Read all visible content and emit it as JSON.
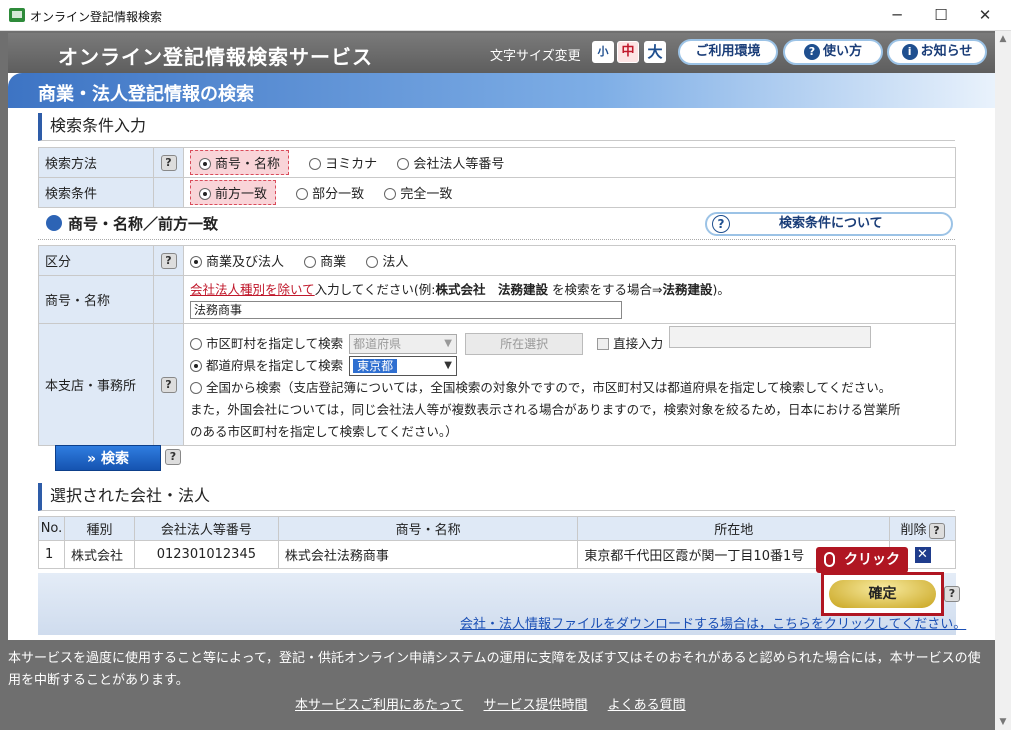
{
  "window": {
    "title": "オンライン登記情報検索"
  },
  "header": {
    "app_title": "オンライン登記情報検索サービス",
    "font_size_label": "文字サイズ変更",
    "font_sizes": [
      "小",
      "中",
      "大"
    ],
    "env_label": "ご利用環境",
    "howto_label": "使い方",
    "notice_label": "お知らせ"
  },
  "banner": {
    "title": "商業・法人登記情報の検索"
  },
  "search_section": {
    "title": "検索条件入力",
    "method_label": "検索方法",
    "method_options": [
      "商号・名称",
      "ヨミカナ",
      "会社法人等番号"
    ],
    "condition_label": "検索条件",
    "condition_options": [
      "前方一致",
      "部分一致",
      "完全一致"
    ]
  },
  "sub": {
    "title": "商号・名称／前方一致",
    "about_label": "検索条件について"
  },
  "form": {
    "kubun_label": "区分",
    "kubun_options": [
      "商業及び法人",
      "商業",
      "法人"
    ],
    "name_label": "商号・名称",
    "name_hint_link": "会社法人種別を除いて",
    "name_hint_rest": "入力してください(例:",
    "name_hint_bold1": "株式会社　法務建設",
    "name_hint_mid": " を検索をする場合⇒",
    "name_hint_bold2": "法務建設",
    "name_hint_end": ")。",
    "name_value": "法務商事",
    "office_label": "本支店・事務所",
    "opt_city": "市区町村を指定して検索",
    "pref_placeholder": "都道府県",
    "locate_btn": "所在選択",
    "direct_label": "直接入力",
    "opt_pref": "都道府県を指定して検索",
    "pref_value": "東京都",
    "opt_all": "全国から検索（支店登記簿については，全国検索の対象外ですので，市区町村又は都道府県を指定して検索してください。",
    "note1": "また，外国会社については，同じ会社法人等が複数表示される場合がありますので，検索対象を絞るため，日本における営業所",
    "note2": "のある市区町村を指定して検索してください。）"
  },
  "search_btn": "検索",
  "result": {
    "title": "選択された会社・法人",
    "headers": [
      "No.",
      "種別",
      "会社法人等番号",
      "商号・名称",
      "所在地",
      "削除"
    ],
    "row": {
      "no": "1",
      "type": "株式会社",
      "number": "012301012345",
      "name": "株式会社法務商事",
      "address": "東京都千代田区霞が関一丁目10番1号"
    }
  },
  "tooltip": "クリック",
  "confirm": "確定",
  "download_link": "会社・法人情報ファイルをダウンロードする場合は，こちらをクリックしてください。",
  "bottom": {
    "notice": "本サービスを過度に使用すること等によって，登記・供託オンライン申請システムの運用に支障を及ぼす又はそのおそれがあると認められた場合には，本サービスの使用を中断することがあります。",
    "links": [
      "本サービスご利用にあたって",
      "サービス提供時間",
      "よくある質問"
    ]
  }
}
